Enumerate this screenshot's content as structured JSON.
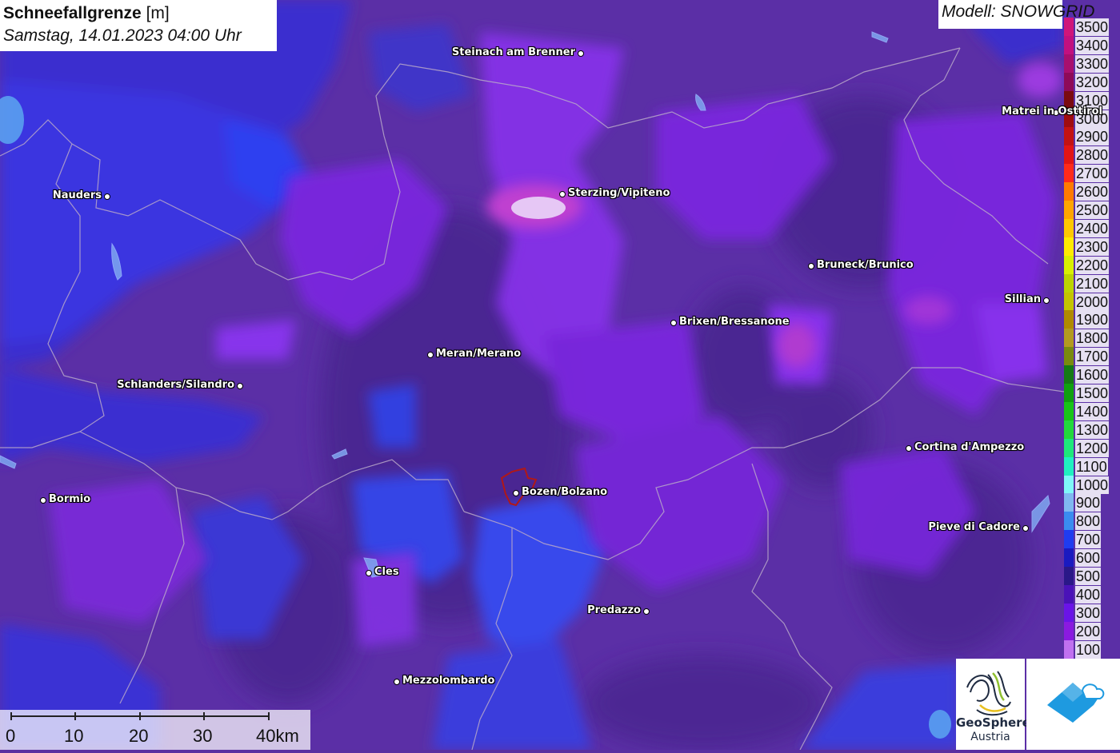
{
  "title": {
    "main_bold": "Schneefallgrenze",
    "main_unit": " [m]",
    "subtitle": "Samstag, 14.01.2023 04:00 Uhr"
  },
  "model_label": "Modell: SNOWGRID",
  "legend": {
    "items": [
      {
        "label": "3500",
        "color": "#d0157a"
      },
      {
        "label": "3400",
        "color": "#c2107f"
      },
      {
        "label": "3300",
        "color": "#a80f6e"
      },
      {
        "label": "3200",
        "color": "#8e0a58"
      },
      {
        "label": "3100",
        "color": "#7a0a10"
      },
      {
        "label": "3000",
        "color": "#a00c10"
      },
      {
        "label": "2900",
        "color": "#c41212"
      },
      {
        "label": "2800",
        "color": "#e21515"
      },
      {
        "label": "2700",
        "color": "#ff2a1a"
      },
      {
        "label": "2600",
        "color": "#ff7b00"
      },
      {
        "label": "2500",
        "color": "#ffa500"
      },
      {
        "label": "2400",
        "color": "#ffc800"
      },
      {
        "label": "2300",
        "color": "#ffeb00"
      },
      {
        "label": "2200",
        "color": "#d8f000"
      },
      {
        "label": "2100",
        "color": "#bcd400"
      },
      {
        "label": "2000",
        "color": "#c4c400"
      },
      {
        "label": "1900",
        "color": "#b08a00"
      },
      {
        "label": "1800",
        "color": "#b39a20"
      },
      {
        "label": "1700",
        "color": "#7a8a10"
      },
      {
        "label": "1600",
        "color": "#157a15"
      },
      {
        "label": "1500",
        "color": "#10a010"
      },
      {
        "label": "1400",
        "color": "#18c418"
      },
      {
        "label": "1300",
        "color": "#22d83c"
      },
      {
        "label": "1200",
        "color": "#1ee87a"
      },
      {
        "label": "1100",
        "color": "#20f0c0"
      },
      {
        "label": "1000",
        "color": "#7ff8f8"
      },
      {
        "label": "900",
        "color": "#80b8f0"
      },
      {
        "label": "800",
        "color": "#3a8cf0"
      },
      {
        "label": "700",
        "color": "#1f3cf0"
      },
      {
        "label": "600",
        "color": "#1a1ac0"
      },
      {
        "label": "500",
        "color": "#2a1888"
      },
      {
        "label": "400",
        "color": "#4a12b8"
      },
      {
        "label": "300",
        "color": "#6a14e8"
      },
      {
        "label": "200",
        "color": "#8a1ae0"
      },
      {
        "label": "100",
        "color": "#c070f0"
      }
    ]
  },
  "cities": [
    {
      "name": "Steinach am Brenner",
      "dot_side": "right"
    },
    {
      "name": "Sterzing/Vipiteno",
      "dot_side": "left"
    },
    {
      "name": "Nauders",
      "dot_side": "right"
    },
    {
      "name": "Bruneck/Brunico",
      "dot_side": "left"
    },
    {
      "name": "Matrei in Osttirol",
      "dot_side": "right"
    },
    {
      "name": "Sillian",
      "dot_side": "right"
    },
    {
      "name": "Brixen/Bressanone",
      "dot_side": "left"
    },
    {
      "name": "Meran/Merano",
      "dot_side": "left"
    },
    {
      "name": "Schlanders/Silandro",
      "dot_side": "right"
    },
    {
      "name": "Cortina d'Ampezzo",
      "dot_side": "left"
    },
    {
      "name": "Bormio",
      "dot_side": "left"
    },
    {
      "name": "Bozen/Bolzano",
      "dot_side": "left"
    },
    {
      "name": "Pieve di Cadore",
      "dot_side": "right"
    },
    {
      "name": "Cles",
      "dot_side": "left"
    },
    {
      "name": "Predazzo",
      "dot_side": "right"
    },
    {
      "name": "Mezzolombardo",
      "dot_side": "left"
    }
  ],
  "scale_bar": {
    "labels": [
      "0",
      "10",
      "20",
      "30",
      "40km"
    ]
  },
  "logos": {
    "geosphere_line1": "GeoSphere",
    "geosphere_line2": "Austria"
  },
  "icons": {
    "geosphere_logo": "geosphere-logo-icon",
    "app_logo": "snow-app-logo-icon",
    "city_marker": "city-dot-icon"
  }
}
